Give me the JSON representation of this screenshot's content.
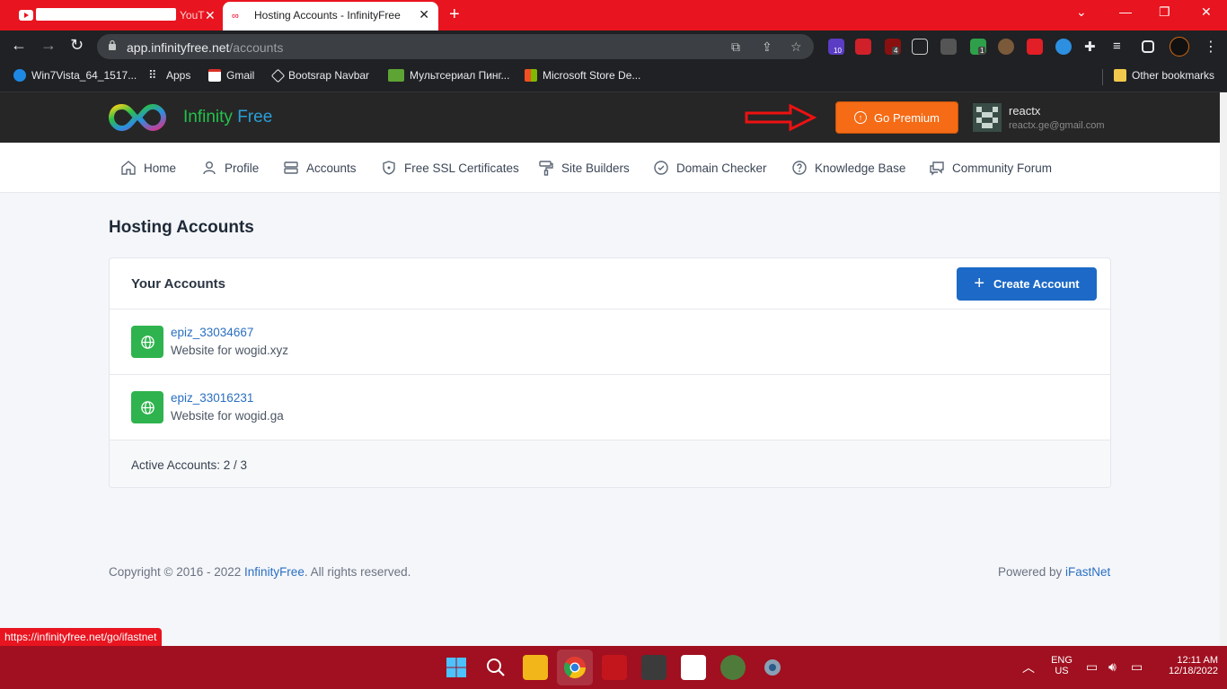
{
  "browser": {
    "tabs": [
      {
        "title": "YouT",
        "active": false
      },
      {
        "title": "Hosting Accounts - InfinityFree",
        "active": true
      }
    ],
    "url_host": "app.infinityfree.net",
    "url_path": "/accounts",
    "extension_badges": [
      "10",
      "4",
      "1"
    ],
    "bookmarks": [
      "Win7Vista_64_1517...",
      "Apps",
      "Gmail",
      "Bootsrap Navbar",
      "Мультсериал Пинг...",
      "Microsoft Store De..."
    ],
    "other_bookmarks": "Other bookmarks",
    "status_url": "https://infinityfree.net/go/ifastnet"
  },
  "site": {
    "logo_infinity": "Infinity",
    "logo_free": "Free",
    "premium_label": "Go Premium",
    "user_name": "reactx",
    "user_email": "reactx.ge@gmail.com"
  },
  "nav": {
    "items": [
      {
        "label": "Home",
        "icon": "home-icon"
      },
      {
        "label": "Profile",
        "icon": "user-icon"
      },
      {
        "label": "Accounts",
        "icon": "server-icon"
      },
      {
        "label": "Free SSL Certificates",
        "icon": "shield-icon"
      },
      {
        "label": "Site Builders",
        "icon": "paint-roller-icon"
      },
      {
        "label": "Domain Checker",
        "icon": "check-circle-icon"
      },
      {
        "label": "Knowledge Base",
        "icon": "question-circle-icon"
      },
      {
        "label": "Community Forum",
        "icon": "chat-icon"
      }
    ]
  },
  "main": {
    "page_title": "Hosting Accounts",
    "card_title": "Your Accounts",
    "create_label": "Create Account",
    "accounts": [
      {
        "username": "epiz_33034667",
        "description": "Website for wogid.xyz"
      },
      {
        "username": "epiz_33016231",
        "description": "Website for wogid.ga"
      }
    ],
    "active_accounts": "Active Accounts: 2 / 3"
  },
  "footer": {
    "copyright_prefix": "Copyright © 2016 - 2022 ",
    "copyright_link": "InfinityFree",
    "copyright_suffix": ". All rights reserved.",
    "powered_prefix": "Powered by ",
    "powered_link": "iFastNet"
  },
  "taskbar": {
    "lang": "ENG",
    "region": "US",
    "time": "12:11 AM",
    "date": "12/18/2022"
  },
  "colors": {
    "premium": "#f56b16",
    "create": "#1d69c7",
    "account_icon": "#2fb34e",
    "browser_frame": "#e8141f"
  }
}
